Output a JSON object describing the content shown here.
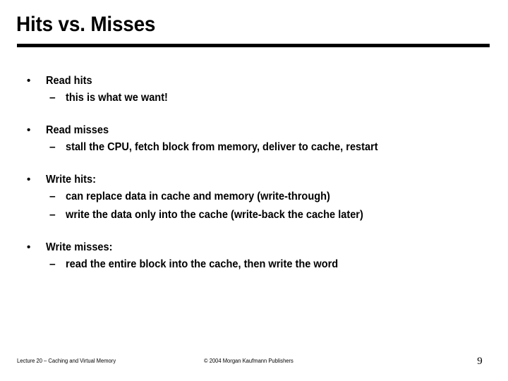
{
  "slide": {
    "title": "Hits vs. Misses",
    "number": "9",
    "accent_color": "#000000",
    "background_color": "#ffffff"
  },
  "content": {
    "bullet_marker": "•",
    "sub_bullet_marker": "–",
    "groups": [
      {
        "heading": "Read hits",
        "subs": [
          "this is what we want!"
        ]
      },
      {
        "heading": "Read misses",
        "subs": [
          "stall the CPU, fetch block from memory, deliver to cache, restart"
        ]
      },
      {
        "heading": "Write hits:",
        "subs": [
          "can replace data in cache and memory (write-through)",
          "write the data only into the cache (write-back the cache later)"
        ]
      },
      {
        "heading": "Write misses:",
        "subs": [
          "read the entire block into the cache, then write the word"
        ]
      }
    ]
  },
  "footer": {
    "left": "Lecture 20 – Caching and Virtual Memory",
    "center": "© 2004 Morgan Kaufmann Publishers",
    "page": "9"
  }
}
